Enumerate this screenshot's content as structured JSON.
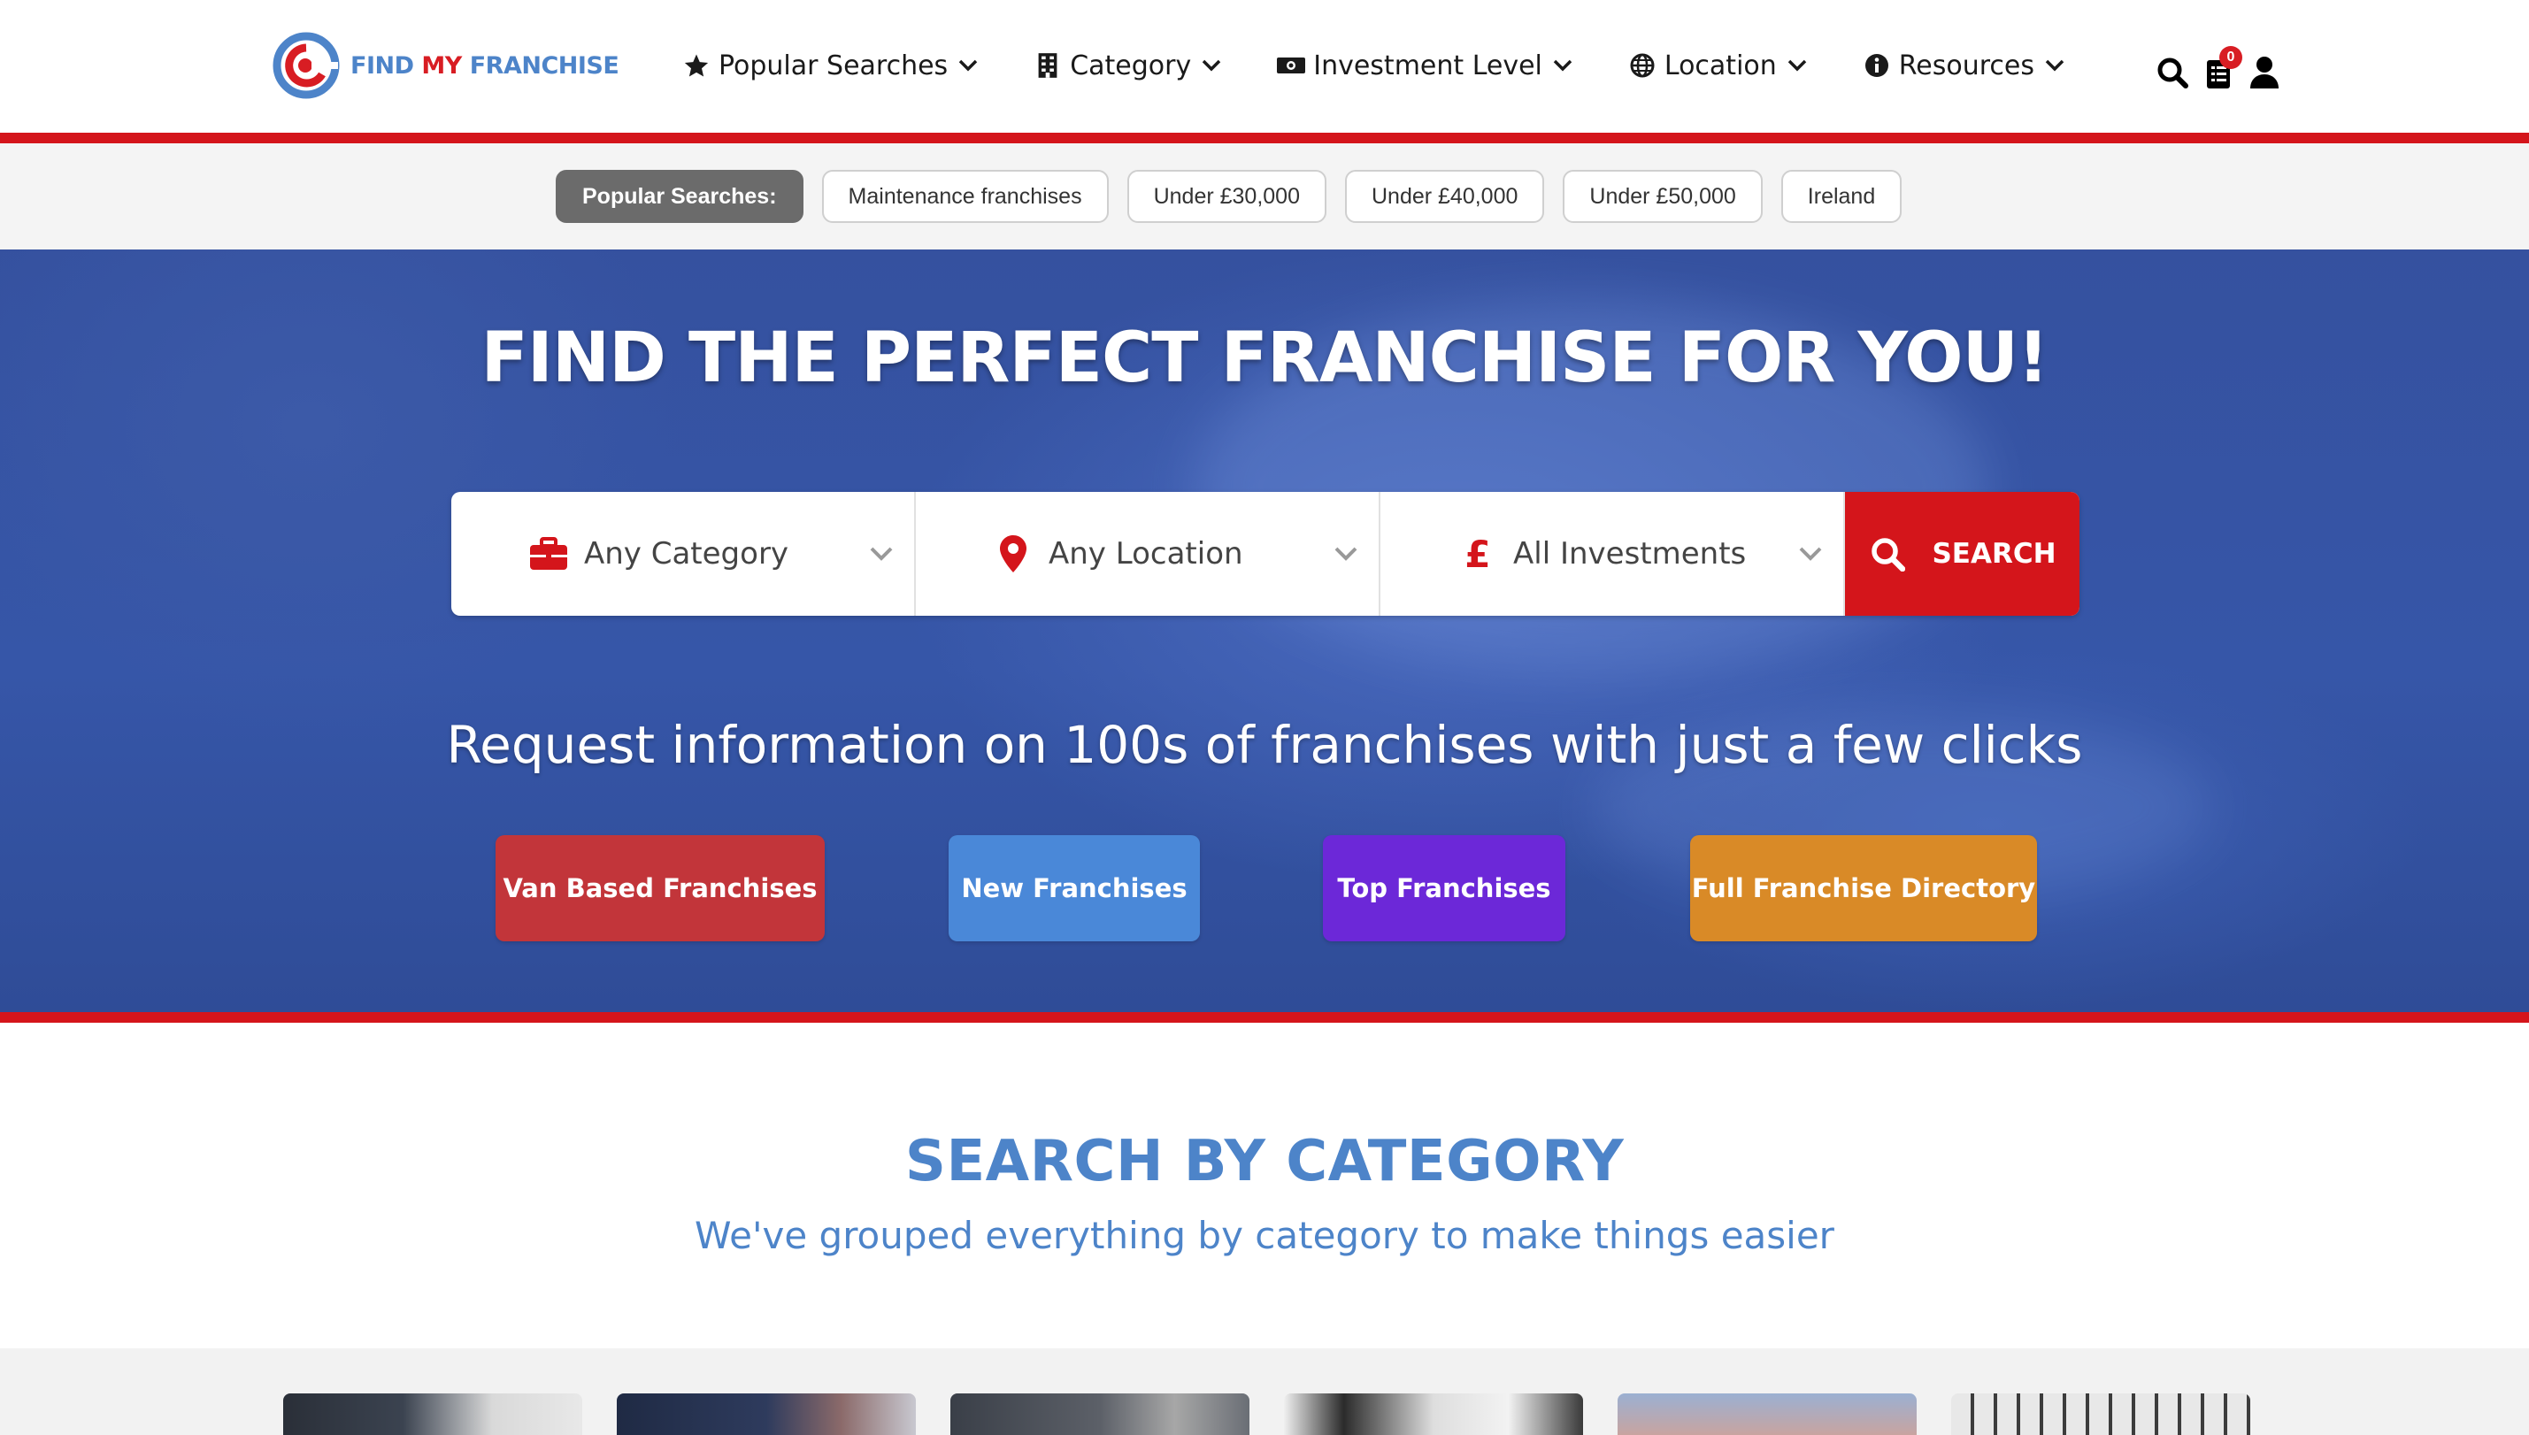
{
  "brand": {
    "name_part1": "FIND",
    "name_part2": "MY",
    "name_part3": "FRANCHISE",
    "primary_blue": "#4d84c9",
    "primary_red": "#d81d23"
  },
  "nav": {
    "items": [
      {
        "label": "Popular Searches",
        "icon": "star-icon"
      },
      {
        "label": "Category",
        "icon": "building-icon"
      },
      {
        "label": "Investment Level",
        "icon": "money-icon"
      },
      {
        "label": "Location",
        "icon": "globe-icon"
      },
      {
        "label": "Resources",
        "icon": "info-icon"
      }
    ],
    "cart_count": "0"
  },
  "popular": {
    "lead": "Popular Searches:",
    "items": [
      "Maintenance franchises",
      "Under £30,000",
      "Under £40,000",
      "Under £50,000",
      "Ireland"
    ]
  },
  "hero": {
    "title": "FIND THE PERFECT FRANCHISE FOR YOU!",
    "subtitle": "Request information on 100s of franchises with just a few clicks",
    "search": {
      "category": "Any Category",
      "location": "Any Location",
      "investment": "All Investments",
      "button": "SEARCH"
    },
    "ctas": [
      {
        "label": "Van Based Franchises",
        "color": "#c2353a"
      },
      {
        "label": "New Franchises",
        "color": "#4a88d8"
      },
      {
        "label": "Top Franchises",
        "color": "#6c28d8"
      },
      {
        "label": "Full Franchise Directory",
        "color": "#d98a27"
      }
    ]
  },
  "category_section": {
    "title": "SEARCH BY CATEGORY",
    "subtitle": "We've grouped everything by category to make things easier"
  }
}
